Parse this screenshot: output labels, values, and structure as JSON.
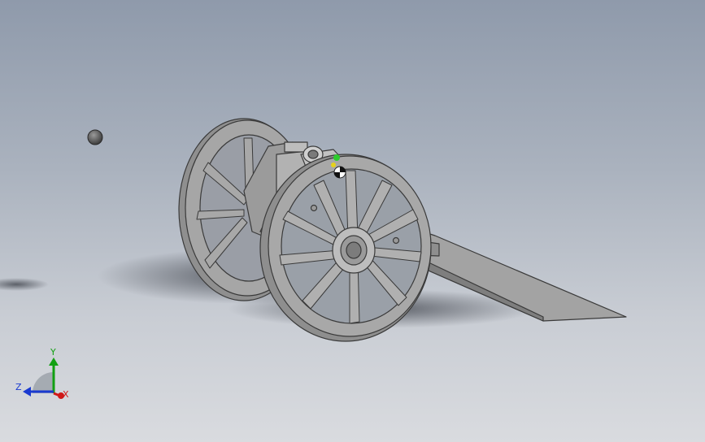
{
  "viewport": {
    "background_top": "#8f9aab",
    "background_bottom": "#d9dbdf",
    "model_fill": "#9c9c9c",
    "model_edge": "#3a3a3a"
  },
  "triad": {
    "x_label": "X",
    "y_label": "Y",
    "z_label": "Z",
    "x_color": "#d01818",
    "y_color": "#12a012",
    "z_color": "#1a3ad0"
  }
}
